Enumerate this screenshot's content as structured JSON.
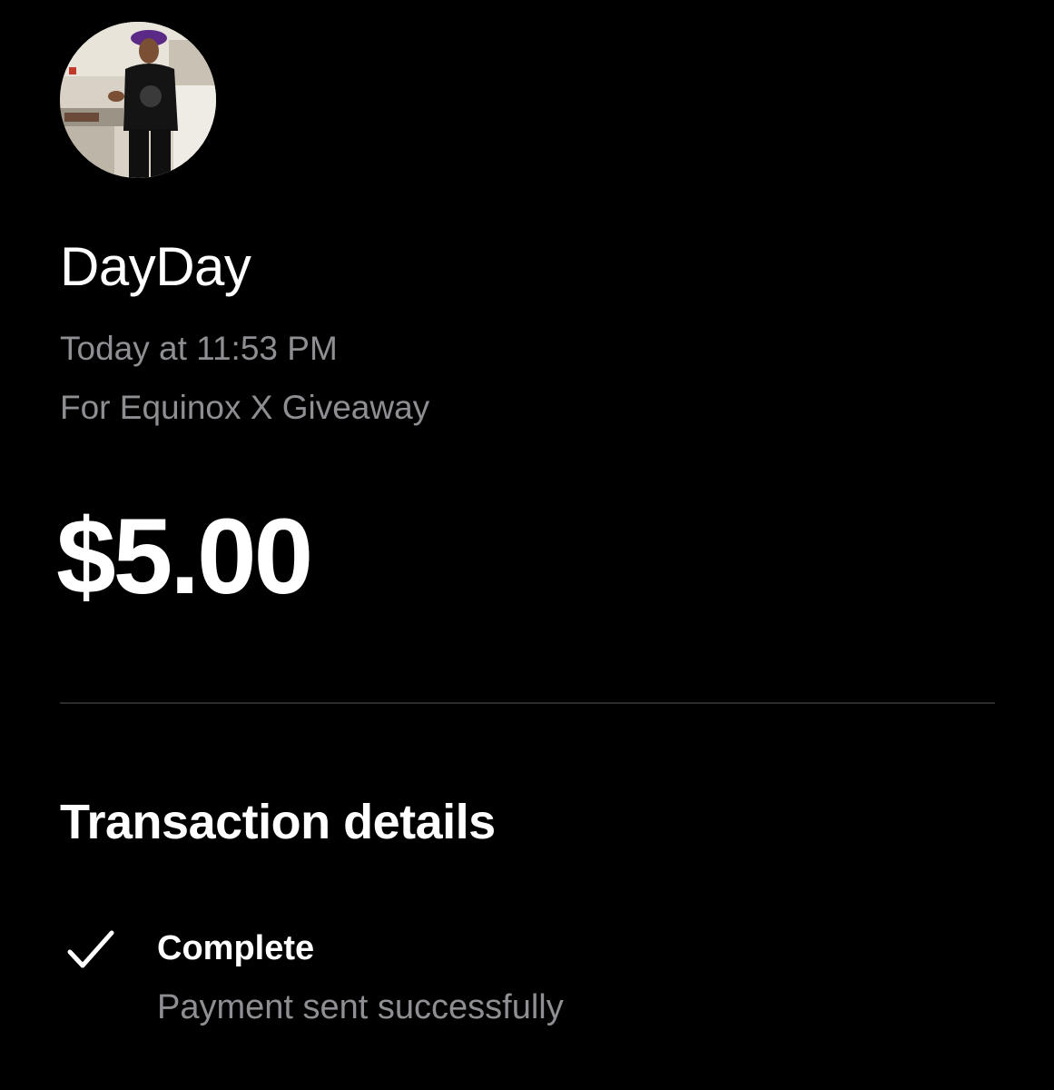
{
  "recipient": {
    "name": "DayDay",
    "avatar_icon": "user-photo"
  },
  "transaction": {
    "time": "Today at 11:53 PM",
    "note": "For Equinox X Giveaway",
    "amount": "$5.00"
  },
  "details": {
    "title": "Transaction details",
    "status": {
      "icon": "check-icon",
      "label": "Complete",
      "description": "Payment sent successfully"
    }
  },
  "colors": {
    "background": "#000000",
    "primary_text": "#ffffff",
    "secondary_text": "#8e8e93",
    "divider": "#2c2c2e"
  }
}
